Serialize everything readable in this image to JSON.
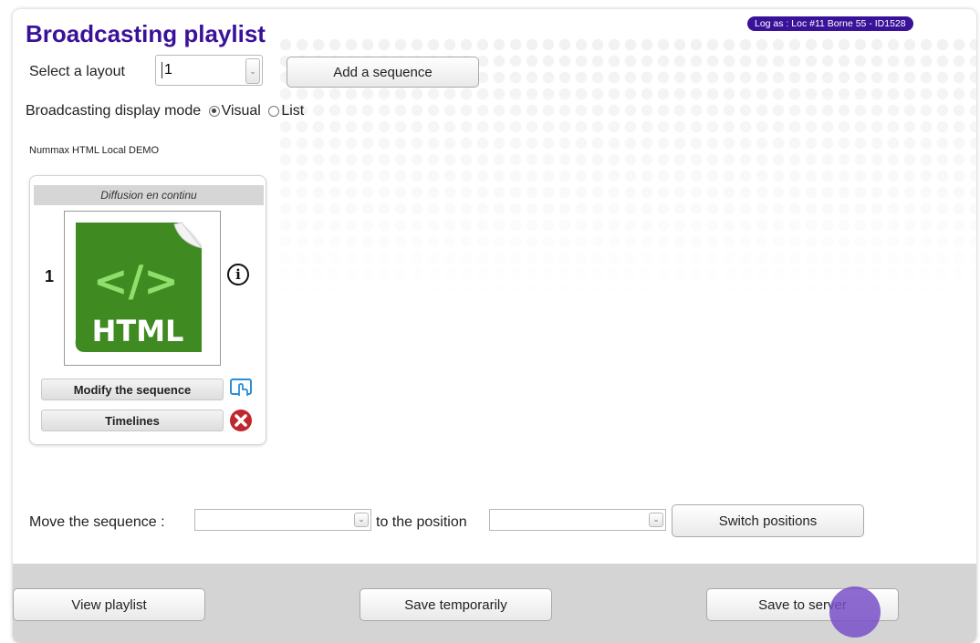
{
  "page": {
    "title": "Broadcasting playlist",
    "login_badge": "Log as : Loc #11 Borne 55 - ID1528"
  },
  "layout_select": {
    "label": "Select a layout",
    "value": "1"
  },
  "add_sequence_label": "Add a sequence",
  "display_mode": {
    "label": "Broadcasting display mode",
    "options": [
      "Visual",
      "List"
    ],
    "selected": "Visual"
  },
  "playlist_name": "Nummax HTML Local DEMO",
  "sequence_card": {
    "header": "Diffusion en continu",
    "number": "1",
    "thumbnail_text": "HTML",
    "thumbnail_code": "</>",
    "modify_label": "Modify the sequence",
    "timelines_label": "Timelines"
  },
  "move_row": {
    "label": "Move the sequence :",
    "to_label": "to the position",
    "switch_label": "Switch positions"
  },
  "footer": {
    "view_playlist": "View playlist",
    "save_temporarily": "Save temporarily",
    "save_to_server": "Save to server"
  },
  "colors": {
    "accent": "#3a1299",
    "html_green": "#3f8a21",
    "delete_red": "#c0262d",
    "touch_blue": "#2a8ed6"
  }
}
